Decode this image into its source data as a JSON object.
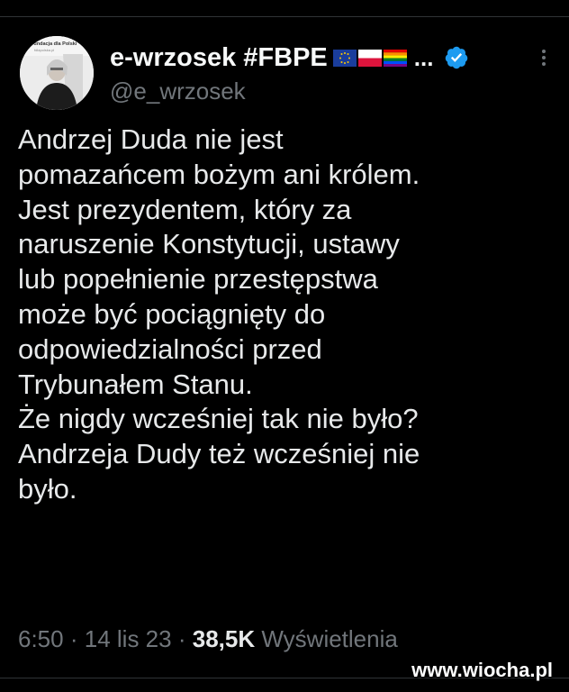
{
  "tweet": {
    "display_name": "e-wrzosek #FBPE",
    "name_overflow": "...",
    "handle": "@e_wrzosek",
    "text_lines": [
      "Andrzej Duda nie jest",
      "pomazańcem bożym ani królem.",
      "Jest prezydentem, który za",
      "naruszenie Konstytucji, ustawy",
      "lub popełnienie przestępstwa",
      "może być pociągnięty do",
      "odpowiedzialności przed",
      "Trybunałem Stanu.",
      "Że nigdy wcześniej tak nie było?",
      "Andrzeja Dudy też wcześniej nie",
      "było."
    ],
    "time": "6:50",
    "separator": "·",
    "date": "14 lis 23",
    "views_count": "38,5K",
    "views_label": "Wyświetlenia",
    "flags": [
      "eu-flag",
      "poland-flag",
      "rainbow-flag"
    ],
    "verified_badge": "verified-badge-icon",
    "more_icon": "more-vertical-icon"
  },
  "avatar": {
    "banner_text": "Fundacja dla Polski",
    "banner_subtext": "fdlapolska.pl"
  },
  "watermark": "www.wiocha.pl",
  "colors": {
    "background": "#000000",
    "text": "#e7e9ea",
    "secondary": "#71767b",
    "verified": "#1d9bf0"
  }
}
